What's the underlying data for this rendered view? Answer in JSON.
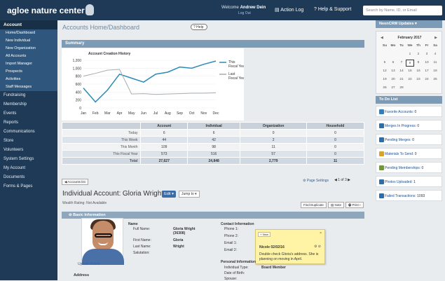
{
  "topbar": {
    "brand": "agloe nature center",
    "welcome_prefix": "Welcome",
    "user_name": "Andrew Dein",
    "logout": "Log Out",
    "action_log": "Action Log",
    "help_support": "Help & Support",
    "search_placeholder": "Search by Name, ID, or Email"
  },
  "sidebar": {
    "account": "Account",
    "account_items": [
      "Home/Dashboard",
      "New Individual",
      "New Organization",
      "All Accounts",
      "Import Manager",
      "Prospects",
      "Activities",
      "Staff Messages"
    ],
    "sections": [
      "Fundraising",
      "Membership",
      "Events",
      "Reports",
      "Communications",
      "Store",
      "Volunteers",
      "System Settings",
      "My Account",
      "Documents",
      "Forms & Pages"
    ]
  },
  "main": {
    "page_title": "Accounts Home/Dashboard",
    "help_label": "Help",
    "summary_label": "Summary",
    "table": {
      "headers": [
        "",
        "Account",
        "Individual",
        "Organization",
        "Household"
      ],
      "rows": [
        [
          "Today",
          "6",
          "6",
          "0",
          "0"
        ],
        [
          "This Week",
          "44",
          "42",
          "2",
          "0"
        ],
        [
          "This Month",
          "109",
          "98",
          "11",
          "0"
        ],
        [
          "This Fiscal Year",
          "573",
          "516",
          "57",
          "0"
        ],
        [
          "Total",
          "27,627",
          "24,848",
          "2,779",
          "11"
        ]
      ]
    },
    "accounts_list": "Accounts list",
    "page_settings": "Page Settings",
    "pager": "1 of 3",
    "account_title_prefix": "Individual Account:",
    "account_name": "Gloria Wright",
    "edit": "Edit",
    "jump_to": "Jump to",
    "wealth": "Wealth Rating: Not Available",
    "find_duplicate": "Find Duplicate",
    "note": "Note",
    "print": "Print",
    "basic_information": "Basic Information",
    "update_delete": "Update Delete",
    "name_section": "Name",
    "fields": [
      {
        "label": "Full Name:",
        "value": "Gloria Wright (36308)"
      },
      {
        "label": "First Name:",
        "value": "Gloria"
      },
      {
        "label": "Last Name:",
        "value": "Wright"
      },
      {
        "label": "Salutation:",
        "value": ""
      }
    ],
    "contact_section": "Contact Information",
    "contact_fields": [
      "Phone 1:",
      "Phone 2:",
      "Email 1:",
      "Email 2:"
    ],
    "personal_section": "Personal Information",
    "personal_fields": [
      {
        "label": "Individual Type:",
        "value": "Board Member"
      },
      {
        "label": "Date of Birth:",
        "value": ""
      },
      {
        "label": "Spouse:",
        "value": ""
      }
    ],
    "address": "Address",
    "note_popup": {
      "new_label": "+ New",
      "author": "Nicole 02/02/16",
      "text": "Double check Gloria's address. She is planning on moving in April."
    }
  },
  "chart_data": {
    "type": "line",
    "title": "Account Creation History",
    "categories": [
      "Jan",
      "Feb",
      "Mar",
      "Apr",
      "May",
      "Jun",
      "Jul",
      "Aug",
      "Sep",
      "Oct",
      "Nov",
      "Dec"
    ],
    "series": [
      {
        "name": "This Fiscal Year",
        "values": [
          500,
          150,
          450,
          850,
          750,
          650,
          850,
          900,
          1030,
          1000,
          1100,
          1180
        ],
        "color": "#2a8ab8"
      },
      {
        "name": "Last Fiscal Year",
        "values": [
          800,
          870,
          950,
          970,
          350,
          360,
          340,
          350,
          360,
          370,
          370,
          380
        ],
        "color": "#a7acb1"
      }
    ],
    "ylim": [
      0,
      1200
    ],
    "yticks": [
      "0",
      "200",
      "400",
      "600",
      "800",
      "1,000",
      "1,200"
    ]
  },
  "right": {
    "neoncrm_updates": "NeonCRM Updates",
    "calendar": {
      "month": "February 2017",
      "days": [
        "Su",
        "Mo",
        "Tu",
        "We",
        "Th",
        "Fr",
        "Sa"
      ],
      "weeks": [
        [
          "",
          "",
          "",
          "1",
          "2",
          "3",
          "4"
        ],
        [
          "5",
          "6",
          "7",
          "8",
          "9",
          "10",
          "11"
        ],
        [
          "12",
          "13",
          "14",
          "15",
          "16",
          "17",
          "18"
        ],
        [
          "19",
          "20",
          "21",
          "22",
          "23",
          "24",
          "25"
        ],
        [
          "26",
          "27",
          "28",
          "",
          "",
          "",
          ""
        ]
      ],
      "selected": "8"
    },
    "todo_title": "To Do List",
    "todo_items": [
      {
        "label": "Favorite Accounts:",
        "value": "0",
        "color": "#2b7fc4"
      },
      {
        "label": "Merges In Progress:",
        "value": "0",
        "color": "#2f6da6"
      },
      {
        "label": "Pending Merges:",
        "value": "0",
        "color": "#2f6da6"
      },
      {
        "label": "Materials To Send:",
        "value": "0",
        "color": "#d8a22a"
      },
      {
        "label": "Pending Memberships:",
        "value": "0",
        "color": "#6d9a37"
      },
      {
        "label": "Photos Uploaded:",
        "value": "1",
        "color": "#2f6da6"
      },
      {
        "label": "Failed Transactions:",
        "value": "1093",
        "color": "#2f6da6"
      }
    ]
  }
}
